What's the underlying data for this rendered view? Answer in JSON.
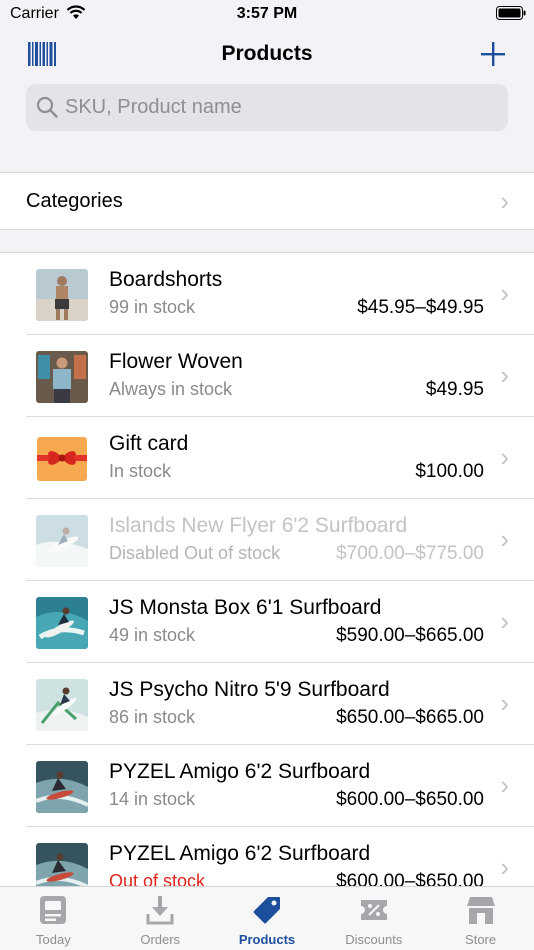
{
  "status_bar": {
    "carrier": "Carrier",
    "time": "3:57 PM"
  },
  "nav": {
    "title": "Products"
  },
  "search": {
    "placeholder": "SKU, Product name"
  },
  "categories": {
    "label": "Categories"
  },
  "products": [
    {
      "name": "Boardshorts",
      "stock": "99 in stock",
      "price": "$45.95–$49.95",
      "disabled": false
    },
    {
      "name": "Flower Woven",
      "stock": "Always in stock",
      "price": "$49.95",
      "disabled": false
    },
    {
      "name": "Gift card",
      "stock": "In stock",
      "price": "$100.00",
      "disabled": false
    },
    {
      "name": "Islands New Flyer 6'2 Surfboard",
      "stock": "Disabled  Out of stock",
      "price": "$700.00–$775.00",
      "disabled": true
    },
    {
      "name": "JS Monsta Box 6'1 Surfboard",
      "stock": "49 in stock",
      "price": "$590.00–$665.00",
      "disabled": false
    },
    {
      "name": "JS Psycho Nitro 5'9 Surfboard",
      "stock": "86 in stock",
      "price": "$650.00–$665.00",
      "disabled": false
    },
    {
      "name": "PYZEL Amigo 6'2 Surfboard",
      "stock": "14 in stock",
      "price": "$600.00–$650.00",
      "disabled": false
    },
    {
      "name": "PYZEL Amigo 6'2 Surfboard",
      "stock": "Out of stock",
      "price": "$600.00–$650.00",
      "disabled": false,
      "stock_alert": true
    }
  ],
  "tabs": [
    {
      "label": "Today",
      "icon": "today-icon",
      "active": false
    },
    {
      "label": "Orders",
      "icon": "download-icon",
      "active": false
    },
    {
      "label": "Products",
      "icon": "tag-icon",
      "active": true
    },
    {
      "label": "Discounts",
      "icon": "discount-icon",
      "active": false
    },
    {
      "label": "Store",
      "icon": "store-icon",
      "active": false
    }
  ],
  "colors": {
    "accent": "#1d4f9c",
    "alert": "#e0251b",
    "background": "#f2f2f7"
  }
}
